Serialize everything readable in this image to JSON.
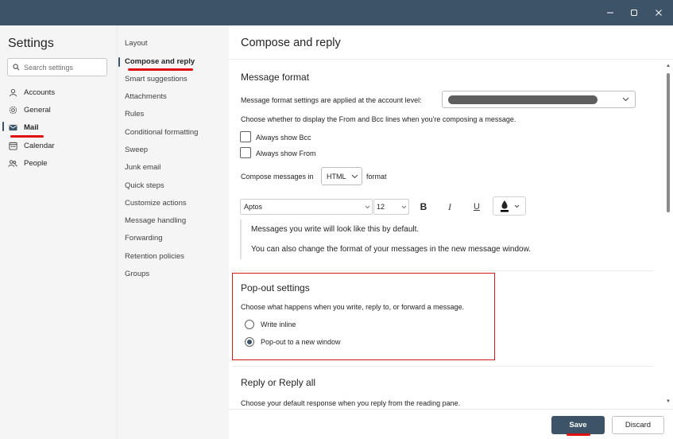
{
  "window": {
    "minimize_icon": "minimize-icon",
    "maximize_icon": "maximize-icon",
    "close_icon": "close-icon"
  },
  "settings": {
    "title": "Settings",
    "search_placeholder": "Search settings"
  },
  "nav1": {
    "items": [
      {
        "label": "Accounts",
        "icon": "person-icon"
      },
      {
        "label": "General",
        "icon": "gear-icon"
      },
      {
        "label": "Mail",
        "icon": "mail-icon",
        "selected": true
      },
      {
        "label": "Calendar",
        "icon": "calendar-icon"
      },
      {
        "label": "People",
        "icon": "people-icon"
      }
    ]
  },
  "nav2": {
    "items": [
      {
        "label": "Layout"
      },
      {
        "label": "Compose and reply",
        "selected": true
      },
      {
        "label": "Smart suggestions"
      },
      {
        "label": "Attachments"
      },
      {
        "label": "Rules"
      },
      {
        "label": "Conditional formatting"
      },
      {
        "label": "Sweep"
      },
      {
        "label": "Junk email"
      },
      {
        "label": "Quick steps"
      },
      {
        "label": "Customize actions"
      },
      {
        "label": "Message handling"
      },
      {
        "label": "Forwarding"
      },
      {
        "label": "Retention policies"
      },
      {
        "label": "Groups"
      }
    ]
  },
  "main": {
    "title": "Compose and reply",
    "message_format": {
      "heading": "Message format",
      "account_level_text": "Message format settings are applied at the account level:",
      "from_bcc_text": "Choose whether to display the From and Bcc lines when you're composing a message.",
      "always_show_bcc": "Always show Bcc",
      "always_show_from": "Always show From",
      "compose_in_prefix": "Compose messages in",
      "compose_format": "HTML",
      "compose_in_suffix": "format",
      "font_name": "Aptos",
      "font_size": "12",
      "bold_glyph": "B",
      "italic_glyph": "I",
      "underline_glyph": "U",
      "preview_line1": "Messages you write will look like this by default.",
      "preview_line2": "You can also change the format of your messages in the new message window."
    },
    "popout": {
      "heading": "Pop-out settings",
      "description": "Choose what happens when you write, reply to, or forward a message.",
      "option_inline": "Write inline",
      "option_new_window": "Pop-out to a new window",
      "selected": "Pop-out to a new window"
    },
    "reply": {
      "heading": "Reply or Reply all",
      "description": "Choose your default response when you reply from the reading pane."
    }
  },
  "footer": {
    "save_label": "Save",
    "discard_label": "Discard"
  },
  "colors": {
    "titlebar": "#3d5367",
    "accent": "#3d5367",
    "annotation_red": "#e01010"
  }
}
